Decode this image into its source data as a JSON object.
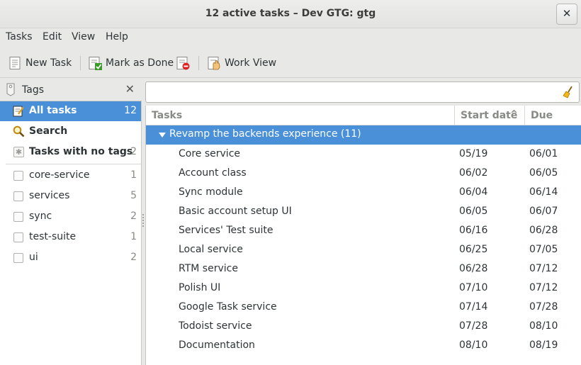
{
  "window": {
    "title": "12 active tasks – Dev GTG: gtg",
    "close_label": "✕"
  },
  "menubar": [
    "Tasks",
    "Edit",
    "View",
    "Help"
  ],
  "toolbar": {
    "new_task": "New Task",
    "mark_done": "Mark as Done",
    "work_view": "Work View"
  },
  "sidebar": {
    "header": "Tags",
    "close": "✕",
    "items": [
      {
        "label": "All tasks",
        "count": "12",
        "active": true
      },
      {
        "label": "Search",
        "count": ""
      },
      {
        "label": "Tasks with no tags",
        "count": "2"
      }
    ],
    "tags": [
      {
        "label": "core-service",
        "count": "1"
      },
      {
        "label": "services",
        "count": "5"
      },
      {
        "label": "sync",
        "count": "2"
      },
      {
        "label": "test-suite",
        "count": "1"
      },
      {
        "label": "ui",
        "count": "2"
      }
    ]
  },
  "search": {
    "value": "",
    "placeholder": ""
  },
  "table": {
    "headers": {
      "tasks": "Tasks",
      "start": "Start date",
      "due": "Due"
    },
    "sort_indicator": "^",
    "group": "Revamp the backends experience (11)",
    "rows": [
      {
        "name": "Core service",
        "start": "05/19",
        "due": "06/01"
      },
      {
        "name": "Account class",
        "start": "06/02",
        "due": "06/05"
      },
      {
        "name": "Sync module",
        "start": "06/04",
        "due": "06/14"
      },
      {
        "name": "Basic account setup UI",
        "start": "06/05",
        "due": "06/07"
      },
      {
        "name": "Services' Test suite",
        "start": "06/16",
        "due": "06/28"
      },
      {
        "name": "Local service",
        "start": "06/25",
        "due": "07/05"
      },
      {
        "name": "RTM service",
        "start": "06/28",
        "due": "07/12"
      },
      {
        "name": "Polish UI",
        "start": "07/10",
        "due": "07/12"
      },
      {
        "name": "Google Task service",
        "start": "07/14",
        "due": "07/28"
      },
      {
        "name": "Todoist service",
        "start": "07/28",
        "due": "08/10"
      },
      {
        "name": "Documentation",
        "start": "08/10",
        "due": "08/19"
      }
    ]
  },
  "colors": {
    "selection": "#4a90d9",
    "window_bg": "#e8e8e7",
    "text": "#2e3436"
  }
}
